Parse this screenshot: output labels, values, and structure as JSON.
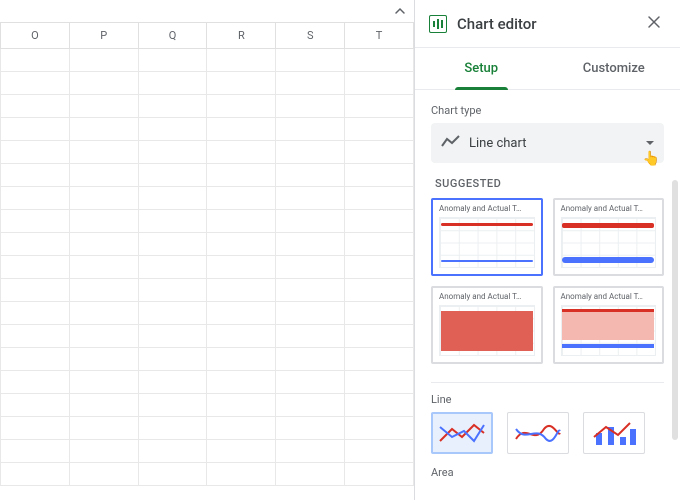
{
  "sheet": {
    "columns": [
      "O",
      "P",
      "Q",
      "R",
      "S",
      "T"
    ],
    "visible_rows": 19
  },
  "panel": {
    "title": "Chart editor",
    "tabs": {
      "setup": "Setup",
      "customize": "Customize"
    },
    "chart_type_label": "Chart type",
    "chart_type_value": "Line chart",
    "suggested_label": "SUGGESTED",
    "suggested_card_title": "Anomaly and Actual T…",
    "line_label": "Line",
    "area_label": "Area"
  }
}
